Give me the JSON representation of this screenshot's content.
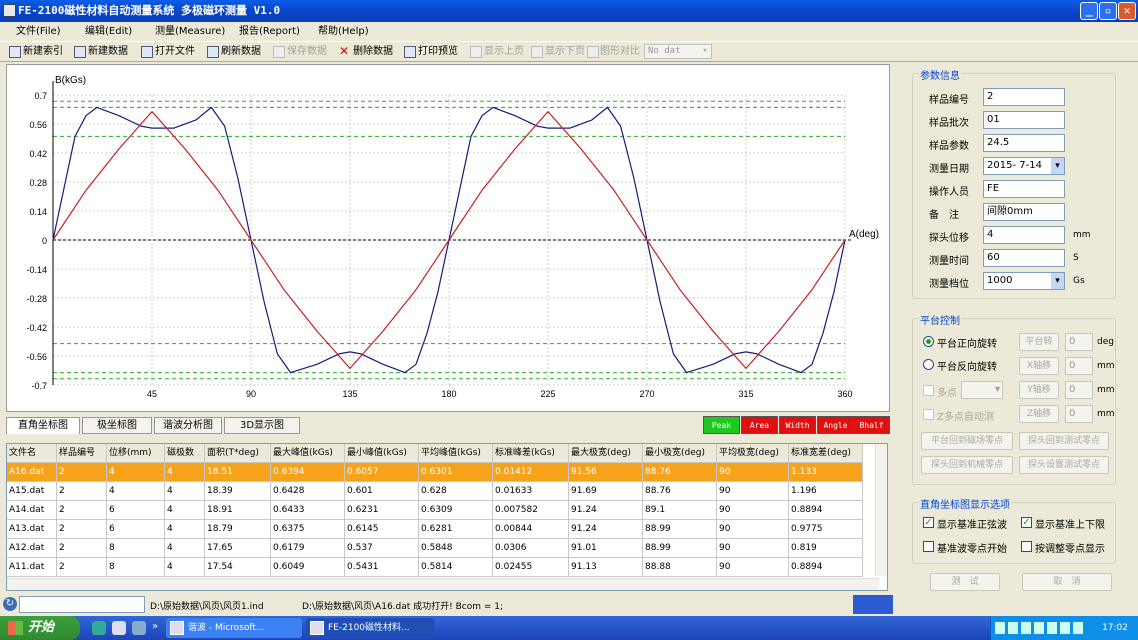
{
  "window": {
    "title": "FE-2100磁性材料自动测量系统 多极磁环测量 V1.0"
  },
  "menu": [
    {
      "label": "文件(File)"
    },
    {
      "label": "编辑(Edit)"
    },
    {
      "label": "测量(Measure)"
    },
    {
      "label": "报告(Report)"
    },
    {
      "label": "帮助(Help)"
    }
  ],
  "toolbar": {
    "items": [
      {
        "label": "新建索引",
        "enabled": true
      },
      {
        "label": "新建数据",
        "enabled": true
      },
      {
        "label": "打开文件",
        "enabled": true
      },
      {
        "label": "刷新数据",
        "enabled": true
      },
      {
        "label": "保存数据",
        "enabled": false
      },
      {
        "label": "删除数据",
        "enabled": true
      },
      {
        "label": "打印预览",
        "enabled": true
      },
      {
        "label": "显示上页",
        "enabled": false
      },
      {
        "label": "显示下页",
        "enabled": false
      },
      {
        "label": "图形对比",
        "enabled": false
      }
    ],
    "compare_select": "No dat"
  },
  "chart_data": {
    "type": "line",
    "ylabel": "B(kGs)",
    "xlabel": "A(deg)",
    "xlim": [
      0,
      360
    ],
    "ylim": [
      -0.7,
      0.7
    ],
    "x_ticks": [
      45,
      90,
      135,
      180,
      225,
      270,
      315,
      360
    ],
    "y_ticks": [
      "0.7",
      "0.56",
      "0.42",
      "0.28",
      "0.14",
      "0",
      "-0.14",
      "-0.28",
      "-0.42",
      "-0.56",
      "-0.7"
    ],
    "series": [
      {
        "color": "#1a1a7a",
        "x": [
          0,
          6,
          10,
          15,
          20,
          30,
          40,
          45,
          55,
          65,
          72,
          78,
          84,
          90,
          96,
          102,
          108,
          114,
          120,
          130,
          135,
          140,
          150,
          160,
          165,
          170,
          175,
          180,
          186,
          190,
          195,
          200,
          210,
          220,
          225,
          235,
          245,
          252,
          258,
          264,
          270,
          276,
          282,
          288,
          294,
          300,
          310,
          315,
          320,
          330,
          340,
          345,
          350,
          355,
          360
        ],
        "y": [
          0,
          0.3,
          0.5,
          0.6,
          0.64,
          0.6,
          0.55,
          0.54,
          0.54,
          0.58,
          0.64,
          0.55,
          0.3,
          0,
          -0.3,
          -0.55,
          -0.64,
          -0.62,
          -0.6,
          -0.55,
          -0.54,
          -0.55,
          -0.6,
          -0.64,
          -0.6,
          -0.45,
          -0.25,
          0,
          0.3,
          0.5,
          0.6,
          0.64,
          0.6,
          0.55,
          0.54,
          0.54,
          0.58,
          0.64,
          0.55,
          0.3,
          0,
          -0.3,
          -0.55,
          -0.64,
          -0.62,
          -0.6,
          -0.55,
          -0.54,
          -0.55,
          -0.6,
          -0.64,
          -0.6,
          -0.45,
          -0.25,
          0
        ]
      },
      {
        "color": "#c82020",
        "x": [
          0,
          15,
          30,
          45,
          60,
          75,
          90,
          105,
          120,
          135,
          150,
          165,
          180,
          195,
          210,
          225,
          240,
          255,
          270,
          285,
          300,
          315,
          330,
          345,
          360
        ],
        "y": [
          0,
          0.24,
          0.44,
          0.62,
          0.44,
          0.24,
          0,
          -0.24,
          -0.44,
          -0.62,
          -0.44,
          -0.24,
          0,
          0.24,
          0.44,
          0.62,
          0.44,
          0.24,
          0,
          -0.24,
          -0.44,
          -0.62,
          -0.44,
          -0.24,
          0
        ]
      }
    ],
    "reference_lines_green": [
      0.67,
      0.64,
      0.5,
      -0.5,
      -0.64,
      -0.67
    ]
  },
  "view_tabs": [
    {
      "label": "直角坐标图"
    },
    {
      "label": "极坐标图"
    },
    {
      "label": "谐波分析图"
    },
    {
      "label": "3D显示图"
    }
  ],
  "mode_buttons": [
    {
      "label": "Peak",
      "color": "#1ec81e"
    },
    {
      "label": "Area",
      "color": "#e01010"
    },
    {
      "label": "Width",
      "color": "#e01010"
    },
    {
      "label": "Angle",
      "color": "#e01010"
    },
    {
      "label": "Bhalf",
      "color": "#e01010"
    }
  ],
  "table": {
    "headers": [
      "文件名",
      "样品编号",
      "位移(mm)",
      "磁极数",
      "面积(T*deg)",
      "最大峰值(kGs)",
      "最小峰值(kGs)",
      "平均峰值(kGs)",
      "标准峰差(kGs)",
      "最大极宽(deg)",
      "最小极宽(deg)",
      "平均极宽(deg)",
      "标准宽差(deg)"
    ],
    "rows": [
      [
        "A16.dat",
        "2",
        "4",
        "4",
        "18.51",
        "0.6394",
        "0.6057",
        "0.6301",
        "0.01412",
        "91.56",
        "88.76",
        "90",
        "1.133"
      ],
      [
        "A15.dat",
        "2",
        "4",
        "4",
        "18.39",
        "0.6428",
        "0.601",
        "0.628",
        "0.01633",
        "91.69",
        "88.76",
        "90",
        "1.196"
      ],
      [
        "A14.dat",
        "2",
        "6",
        "4",
        "18.91",
        "0.6433",
        "0.6231",
        "0.6309",
        "0.007582",
        "91.24",
        "89.1",
        "90",
        "0.8894"
      ],
      [
        "A13.dat",
        "2",
        "6",
        "4",
        "18.79",
        "0.6375",
        "0.6145",
        "0.6281",
        "0.00844",
        "91.24",
        "88.99",
        "90",
        "0.9775"
      ],
      [
        "A12.dat",
        "2",
        "8",
        "4",
        "17.65",
        "0.6179",
        "0.537",
        "0.5848",
        "0.0306",
        "91.01",
        "88.99",
        "90",
        "0.819"
      ],
      [
        "A11.dat",
        "2",
        "8",
        "4",
        "17.54",
        "0.6049",
        "0.5431",
        "0.5814",
        "0.02455",
        "91.13",
        "88.88",
        "90",
        "0.8894"
      ]
    ]
  },
  "params": {
    "title": "参数信息",
    "fields": [
      {
        "label": "样品编号",
        "value": "2",
        "unit": ""
      },
      {
        "label": "样品批次",
        "value": "01",
        "unit": ""
      },
      {
        "label": "样品参数",
        "value": "24.5",
        "unit": ""
      },
      {
        "label": "测量日期",
        "value": "2015- 7-14",
        "unit": ""
      },
      {
        "label": "操作人员",
        "value": "FE",
        "unit": ""
      },
      {
        "label": "备　注",
        "value": "间隙0mm",
        "unit": ""
      },
      {
        "label": "探头位移",
        "value": "4",
        "unit": "mm"
      },
      {
        "label": "测量时间",
        "value": "60",
        "unit": "S"
      },
      {
        "label": "测量档位",
        "value": "1000",
        "unit": "Gs"
      }
    ]
  },
  "platform": {
    "title": "平台控制",
    "radio_forward": "平台正向旋转",
    "radio_reverse": "平台反向旋转",
    "multi_point": "多点",
    "auto_measure": "Z多点自动测",
    "btn_platform": "平台转",
    "btn_x": "X轴移",
    "btn_y": "Y轴移",
    "btn_z": "Z轴移",
    "val_platform": "0",
    "val_x": "0",
    "val_y": "0",
    "val_z": "0",
    "unit_deg": "deg",
    "unit_mm": "mm",
    "btn_reset_field": "平台回到磁场零点",
    "btn_probe_test": "探头回到测试零点",
    "btn_probe_mech": "探头回到机械零点",
    "btn_probe_set": "探头设置测试零点"
  },
  "display_options": {
    "title": "直角坐标图显示选项",
    "opt1": "显示基准正弦波",
    "opt2": "显示基准上下限",
    "opt3": "基准波零点开始",
    "opt4": "按调整零点显示"
  },
  "footer_buttons": {
    "test": "测　试",
    "cancel": "取　消"
  },
  "status": {
    "path1": "D:\\原始数据\\风页\\风页1.ind",
    "message": "D:\\原始数据\\风页\\A16.dat 成功打开! Bcom = 1;"
  },
  "taskbar": {
    "start": "开始",
    "task1": "谐波 - Microsoft...",
    "task2": "FE-2100磁性材料...",
    "clock": "17:02"
  }
}
